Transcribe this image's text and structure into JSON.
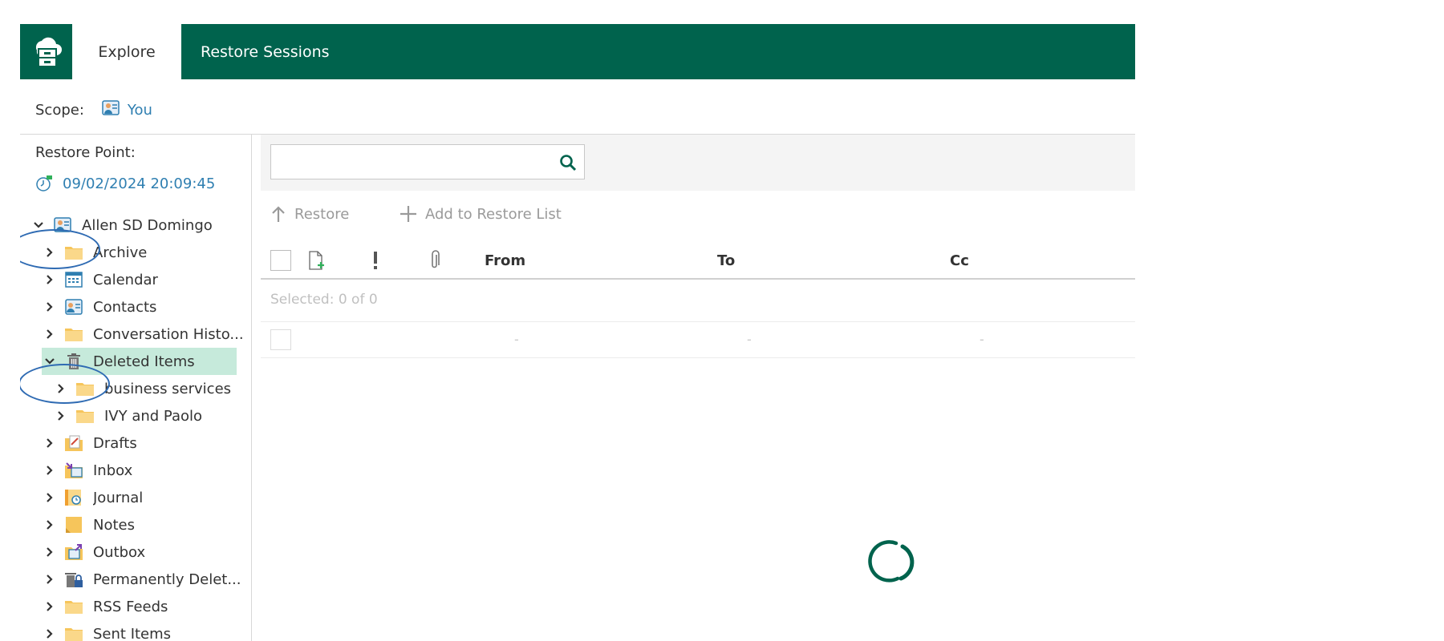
{
  "topbar": {
    "tabs": [
      {
        "label": "Explore",
        "active": true
      },
      {
        "label": "Restore Sessions",
        "active": false
      }
    ],
    "brand_color": "#00634d"
  },
  "scope": {
    "label": "Scope:",
    "value": "You"
  },
  "restore_point": {
    "label": "Restore Point:",
    "value": "09/02/2024 20:09:45"
  },
  "tree": {
    "root": {
      "label": "Allen SD Domingo",
      "expanded": true
    },
    "items": [
      {
        "label": "Archive",
        "icon": "folder-icon"
      },
      {
        "label": "Calendar",
        "icon": "calendar-icon"
      },
      {
        "label": "Contacts",
        "icon": "contacts-icon"
      },
      {
        "label": "Conversation Histo...",
        "icon": "folder-icon"
      },
      {
        "label": "Deleted Items",
        "icon": "trash-icon",
        "selected": true,
        "expanded": true
      },
      {
        "label": "business services",
        "icon": "folder-icon"
      },
      {
        "label": "IVY and Paolo",
        "icon": "folder-icon"
      },
      {
        "label": "Drafts",
        "icon": "drafts-icon"
      },
      {
        "label": "Inbox",
        "icon": "inbox-icon"
      },
      {
        "label": "Journal",
        "icon": "journal-icon"
      },
      {
        "label": "Notes",
        "icon": "notes-icon"
      },
      {
        "label": "Outbox",
        "icon": "outbox-icon"
      },
      {
        "label": "Permanently Delet...",
        "icon": "locked-trash-icon"
      },
      {
        "label": "RSS Feeds",
        "icon": "folder-icon"
      },
      {
        "label": "Sent Items",
        "icon": "folder-icon"
      }
    ]
  },
  "search": {
    "value": "",
    "placeholder": ""
  },
  "toolbar": {
    "restore_label": "Restore",
    "add_label": "Add to Restore List"
  },
  "table": {
    "columns": [
      "From",
      "To",
      "Cc"
    ],
    "selected_text": "Selected: 0 of 0",
    "empty_row": [
      "-",
      "-",
      "-"
    ]
  }
}
